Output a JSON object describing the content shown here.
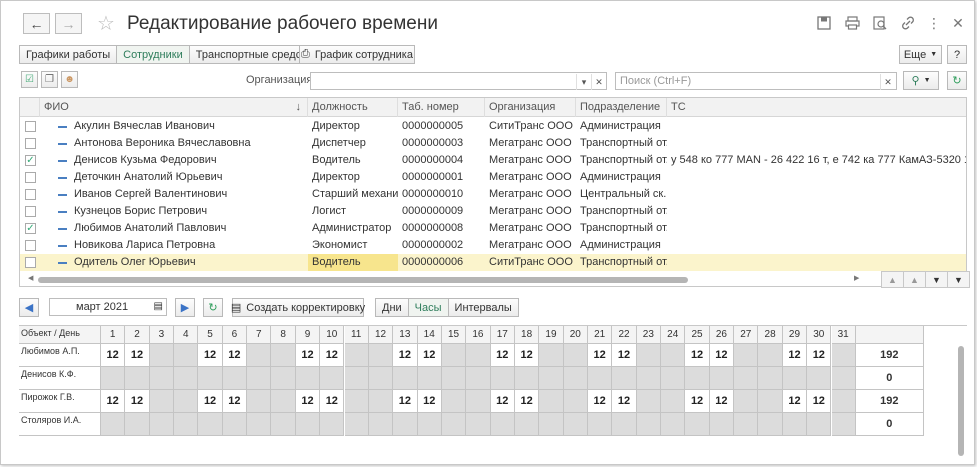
{
  "header": {
    "title": "Редактирование рабочего времени",
    "back_icon": "arrow-left-icon",
    "forward_icon": "arrow-right-icon"
  },
  "tabs": [
    {
      "label": "Графики работы",
      "active": false
    },
    {
      "label": "Сотрудники",
      "active": true
    },
    {
      "label": "Транспортные средства",
      "active": false
    }
  ],
  "toolbar": {
    "schedule_button": "График сотрудника",
    "more_button": "Еще",
    "help_button": "?",
    "organization_label": "Организация:",
    "search_placeholder": "Поиск (Ctrl+F)"
  },
  "table": {
    "columns": [
      "ФИО",
      "Должность",
      "Таб. номер",
      "Организация",
      "Подразделение",
      "ТС"
    ],
    "rows": [
      {
        "checked": false,
        "name": "Акулин Вячеслав Иванович",
        "position": "Директор",
        "tab": "0000000005",
        "org": "СитиТранс ООО",
        "dept": "Администрация",
        "ts": ""
      },
      {
        "checked": false,
        "name": "Антонова Вероника Вячеславовна",
        "position": "Диспетчер",
        "tab": "0000000003",
        "org": "Мегатранс ООО",
        "dept": "Транспортный от...",
        "ts": ""
      },
      {
        "checked": true,
        "name": "Денисов Кузьма Федорович",
        "position": "Водитель",
        "tab": "0000000004",
        "org": "Мегатранс ООО",
        "dept": "Транспортный от...",
        "ts": "у 548 ко 777 MAN - 26 422  16 т, е 742 ка 777 КамАЗ-5320 10т"
      },
      {
        "checked": false,
        "name": "Деточкин Анатолий Юрьевич",
        "position": "Директор",
        "tab": "0000000001",
        "org": "Мегатранс ООО",
        "dept": "Администрация",
        "ts": ""
      },
      {
        "checked": false,
        "name": "Иванов Сергей Валентинович",
        "position": "Старший механик",
        "tab": "0000000010",
        "org": "Мегатранс ООО",
        "dept": "Центральный ск...",
        "ts": ""
      },
      {
        "checked": false,
        "name": "Кузнецов Борис Петрович",
        "position": "Логист",
        "tab": "0000000009",
        "org": "Мегатранс ООО",
        "dept": "Транспортный от...",
        "ts": ""
      },
      {
        "checked": true,
        "name": "Любимов Анатолий Павлович",
        "position": "Администратор",
        "tab": "0000000008",
        "org": "Мегатранс ООО",
        "dept": "Транспортный от...",
        "ts": ""
      },
      {
        "checked": false,
        "name": "Новикова Лариса Петровна",
        "position": "Экономист",
        "tab": "0000000002",
        "org": "Мегатранс ООО",
        "dept": "Администрация",
        "ts": ""
      },
      {
        "checked": false,
        "name": "Одитель Олег Юрьевич",
        "position": "Водитель",
        "tab": "0000000006",
        "org": "СитиТранс ООО",
        "dept": "Транспортный от...",
        "ts": "",
        "selected": true
      }
    ]
  },
  "calendar": {
    "period": "март 2021",
    "create_button": "Создать корректировку",
    "modes": [
      {
        "label": "Дни",
        "active": false
      },
      {
        "label": "Часы",
        "active": true
      },
      {
        "label": "Интервалы",
        "active": false
      }
    ],
    "header_label": "Объект / День",
    "days": [
      "1",
      "2",
      "3",
      "4",
      "5",
      "6",
      "7",
      "8",
      "9",
      "10",
      "11",
      "12",
      "13",
      "14",
      "15",
      "16",
      "17",
      "18",
      "19",
      "20",
      "21",
      "22",
      "23",
      "24",
      "25",
      "26",
      "27",
      "28",
      "29",
      "30",
      "31"
    ],
    "rows": [
      {
        "name": "Любимов А.П.",
        "hours": [
          "12",
          "12",
          "",
          "",
          "12",
          "12",
          "",
          "",
          "12",
          "12",
          "",
          "",
          "12",
          "12",
          "",
          "",
          "12",
          "12",
          "",
          "",
          "12",
          "12",
          "",
          "",
          "12",
          "12",
          "",
          "",
          "12",
          "12",
          ""
        ],
        "total": "192"
      },
      {
        "name": "Денисов К.Ф.",
        "hours": [
          "",
          "",
          "",
          "",
          "",
          "",
          "",
          "",
          "",
          "",
          "",
          "",
          "",
          "",
          "",
          "",
          "",
          "",
          "",
          "",
          "",
          "",
          "",
          "",
          "",
          "",
          "",
          "",
          "",
          "",
          ""
        ],
        "total": "0"
      },
      {
        "name": "Пирожок Г.В.",
        "hours": [
          "12",
          "12",
          "",
          "",
          "12",
          "12",
          "",
          "",
          "12",
          "12",
          "",
          "",
          "12",
          "12",
          "",
          "",
          "12",
          "12",
          "",
          "",
          "12",
          "12",
          "",
          "",
          "12",
          "12",
          "",
          "",
          "12",
          "12",
          ""
        ],
        "total": "192"
      },
      {
        "name": "Столяров И.А.",
        "hours": [
          "",
          "",
          "",
          "",
          "",
          "",
          "",
          "",
          "",
          "",
          "",
          "",
          "",
          "",
          "",
          "",
          "",
          "",
          "",
          "",
          "",
          "",
          "",
          "",
          "",
          "",
          "",
          "",
          "",
          "",
          ""
        ],
        "total": "0"
      }
    ]
  }
}
